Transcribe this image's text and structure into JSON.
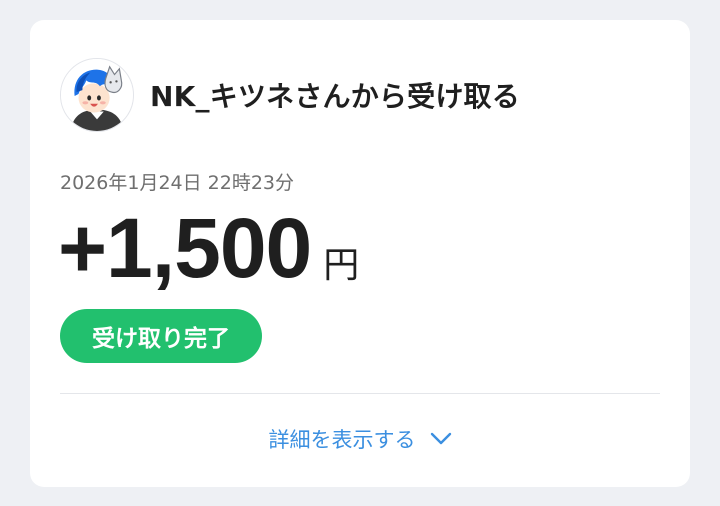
{
  "transaction": {
    "sender_title": "NK_キツネさんから受け取る",
    "datetime": "2026年1月24日 22時23分",
    "amount": "+1,500",
    "currency": "円",
    "status": "受け取り完了",
    "details_label": "詳細を表示する"
  },
  "icons": {
    "avatar": "user-avatar-illustration",
    "details_chevron": "chevron-down-icon"
  },
  "colors": {
    "background": "#eef0f4",
    "card": "#ffffff",
    "status_badge": "#22c06e",
    "link": "#3b8fe0",
    "text_primary": "#1f1f1f",
    "text_secondary": "#6f6f6f"
  }
}
